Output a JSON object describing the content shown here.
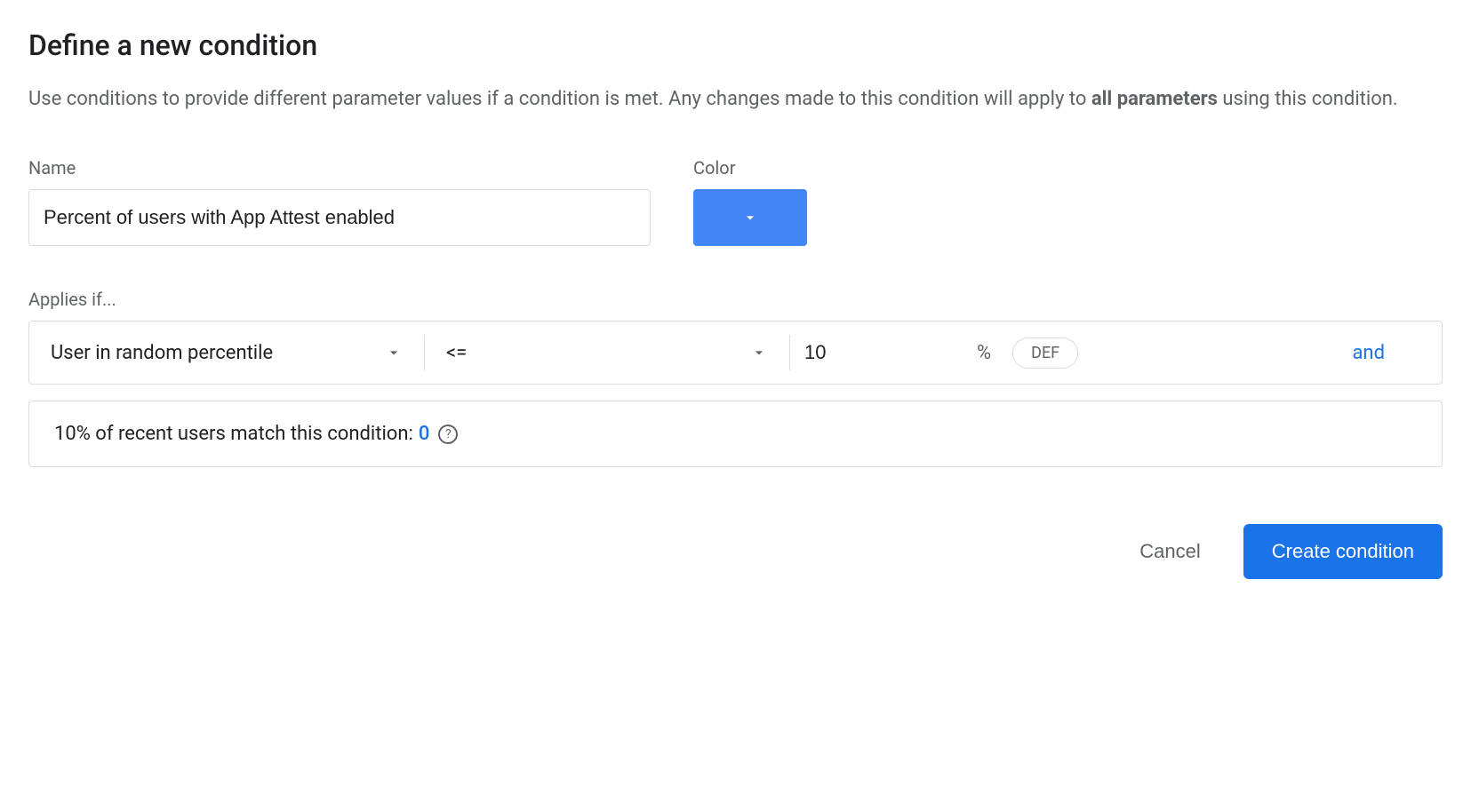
{
  "title": "Define a new condition",
  "description": {
    "prefix": "Use conditions to provide different parameter values if a condition is met. Any changes made to this condition will apply to ",
    "bold": "all parameters",
    "suffix": " using this condition."
  },
  "fields": {
    "name_label": "Name",
    "name_value": "Percent of users with App Attest enabled",
    "color_label": "Color",
    "color_value": "#4285f4"
  },
  "applies": {
    "label": "Applies if...",
    "condition_type": "User in random percentile",
    "operator": "<=",
    "value": "10",
    "unit": "%",
    "seed_label": "DEF",
    "and_label": "and"
  },
  "match_info": {
    "prefix": "10% of recent users match this condition: ",
    "count": "0"
  },
  "actions": {
    "cancel": "Cancel",
    "create": "Create condition"
  }
}
